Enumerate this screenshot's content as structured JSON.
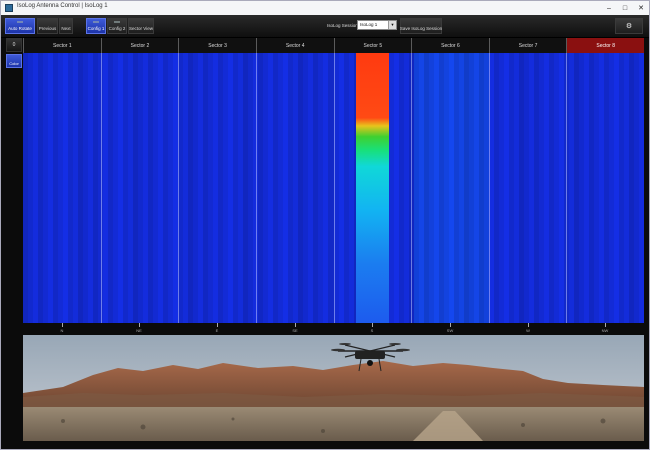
{
  "window": {
    "title": "IsoLog Antenna Control | IsoLog 1"
  },
  "toolbar": {
    "auto_rotate": "Auto Rotate",
    "previous": "Previous",
    "next": "Next",
    "config1": "Config 1",
    "config2": "Config 2",
    "sector_view": "Sector View",
    "session_label": "IsoLog Session:",
    "session_value": "IsoLog 1",
    "save_session": "Save IsoLog Session"
  },
  "side": {
    "zero": "0",
    "color": "Color"
  },
  "sectors": [
    "Sector 1",
    "Sector 2",
    "Sector 3",
    "Sector 4",
    "Sector 5",
    "Sector 6",
    "Sector 7",
    "Sector 8"
  ],
  "selected_sector": "Sector 8",
  "compass": [
    "N",
    "NE",
    "E",
    "SE",
    "S",
    "SW",
    "W",
    "NW"
  ],
  "colors": {
    "active_button": "#2a44c8",
    "selected_sector": "#8a1010",
    "spectrum_background": "#1530e6"
  }
}
